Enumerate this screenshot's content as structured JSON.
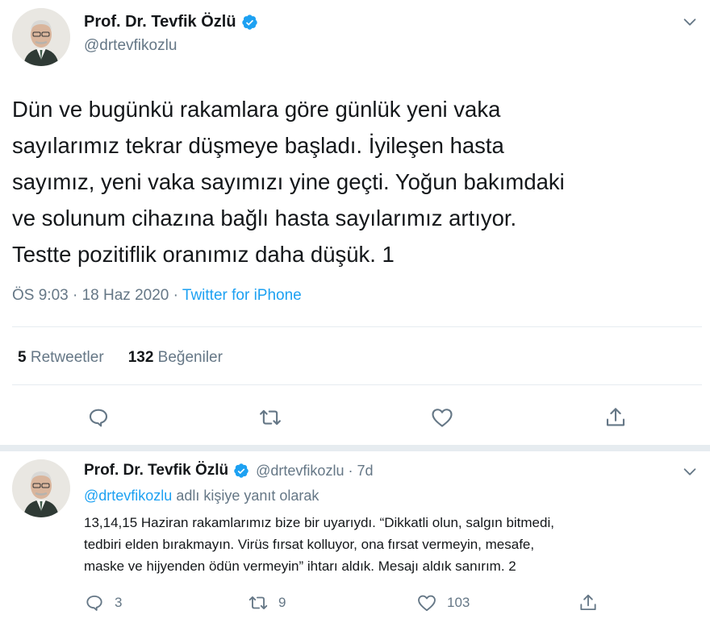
{
  "main_tweet": {
    "author": {
      "display_name": "Prof. Dr. Tevfik Özlü",
      "handle": "@drtevfikozlu",
      "verified": true
    },
    "text_lines": [
      "Dün ve bugünkü rakamlara göre günlük yeni vaka",
      "sayılarımız tekrar düşmeye başladı. İyileşen hasta",
      "sayımız, yeni vaka sayımızı yine geçti.  Yoğun bakımdaki",
      "ve solunum cihazına bağlı hasta sayılarımız artıyor.",
      "Testte pozitiflik oranımız daha düşük. 1"
    ],
    "timestamp": "ÖS 9:03 · 18 Haz 2020 · ",
    "source": "Twitter for iPhone",
    "stats": {
      "retweets_count": "5",
      "retweets_label": "Retweetler",
      "likes_count": "132",
      "likes_label": "Beğeniler"
    },
    "actions": [
      "reply-icon",
      "retweet-icon",
      "like-icon",
      "share-icon"
    ]
  },
  "reply_tweet": {
    "author": {
      "display_name": "Prof. Dr. Tevfik Özlü",
      "handle_time": "@drtevfikozlu · 7d",
      "verified": true
    },
    "reply_to_mention": "@drtevfikozlu",
    "reply_to_suffix": " adlı kişiye yanıt olarak",
    "text_lines": [
      "13,14,15 Haziran rakamlarımız bize bir uyarıydı. “Dikkatli olun, salgın bitmedi,",
      "tedbiri elden bırakmayın. Virüs fırsat kolluyor, ona fırsat vermeyin, mesafe,",
      "maske ve hijyenden ödün vermeyin” ihtarı aldık. Mesajı aldık sanırım. 2"
    ],
    "counts": {
      "replies": "3",
      "retweets": "9",
      "likes": "103"
    }
  },
  "colors": {
    "text": "#14171a",
    "secondary": "#657786",
    "accent": "#1da1f2",
    "divider": "#e6ecf0"
  }
}
